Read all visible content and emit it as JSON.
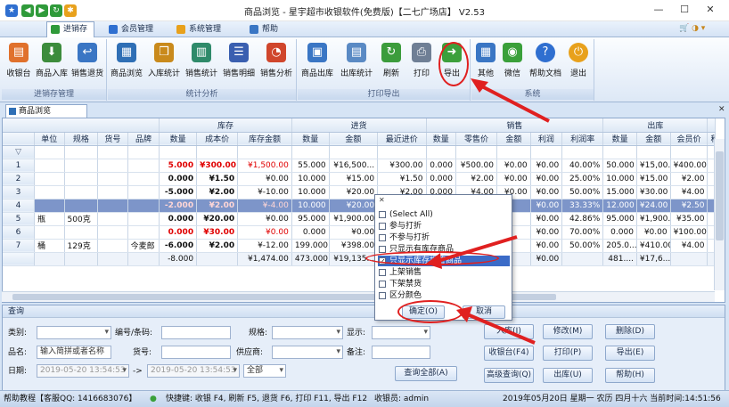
{
  "window": {
    "title": "商品浏览 - 星宇超市收银软件(免费版)【二七广场店】 V2.53",
    "controls": [
      "—",
      "☐",
      "✕"
    ]
  },
  "menu": [
    {
      "label": "进销存",
      "active": true
    },
    {
      "label": "会员管理",
      "active": false
    },
    {
      "label": "系统管理",
      "active": false
    },
    {
      "label": "帮助",
      "active": false
    }
  ],
  "ribbon": {
    "groups": [
      {
        "label": "进销存管理",
        "buttons": [
          {
            "label": "收银台",
            "icon": "cash-register-icon",
            "color": "#e0712c"
          },
          {
            "label": "商品入库",
            "icon": "stock-in-icon",
            "color": "#3c8c3c"
          },
          {
            "label": "销售退货",
            "icon": "return-icon",
            "color": "#3a76c4"
          }
        ]
      },
      {
        "label": "统计分析",
        "buttons": [
          {
            "label": "商品浏览",
            "icon": "browse-icon",
            "color": "#2f6fb5"
          },
          {
            "label": "入库统计",
            "icon": "books-icon",
            "color": "#c98a1c"
          },
          {
            "label": "销售统计",
            "icon": "sales-stat-icon",
            "color": "#2f8a6a"
          },
          {
            "label": "销售明细",
            "icon": "detail-icon",
            "color": "#3a5fb0"
          },
          {
            "label": "销售分析",
            "icon": "pie-chart-icon",
            "color": "#d0462c"
          }
        ]
      },
      {
        "label": "打印导出",
        "buttons": [
          {
            "label": "商品出库",
            "icon": "stock-out-icon",
            "color": "#3a76c4"
          },
          {
            "label": "出库统计",
            "icon": "stock-out-stat-icon",
            "color": "#5a8ac4"
          },
          {
            "label": "刷新",
            "icon": "refresh-icon",
            "color": "#3c9c3c"
          },
          {
            "label": "打印",
            "icon": "printer-icon",
            "color": "#6f7f95"
          },
          {
            "label": "导出",
            "icon": "export-icon",
            "color": "#3ca03c"
          }
        ]
      },
      {
        "label": "系统",
        "buttons": [
          {
            "label": "其他",
            "icon": "apps-icon",
            "color": "#3a76c4"
          },
          {
            "label": "微信",
            "icon": "wechat-icon",
            "color": "#3aa03a"
          },
          {
            "label": "帮助文档",
            "icon": "help-icon",
            "color": "#2f6fd0"
          },
          {
            "label": "退出",
            "icon": "exit-icon",
            "color": "#e8a11c"
          }
        ]
      }
    ]
  },
  "doc_tab": {
    "label": "商品浏览",
    "close": "✕"
  },
  "grid": {
    "group_headers": [
      {
        "label": "库存",
        "cols": 3
      },
      {
        "label": "进货",
        "cols": 3
      },
      {
        "label": "销售",
        "cols": 5
      },
      {
        "label": "出库",
        "cols": 3
      }
    ],
    "columns": [
      "单位",
      "规格",
      "货号",
      "品牌",
      "数量",
      "成本价",
      "库存金额",
      "数量",
      "金额",
      "最近进价",
      "数量",
      "零售价",
      "金额",
      "利润",
      "利润率",
      "数量",
      "金额",
      "会员价",
      "积"
    ],
    "rows": [
      {
        "n": "1",
        "cells": [
          "",
          "",
          "",
          "",
          "5.000",
          "¥300.00",
          "¥1,500.00",
          "55.000",
          "¥16,500...",
          "¥300.00",
          "0.000",
          "¥500.00",
          "¥0.00",
          "¥0.00",
          "40.00%",
          "50.000",
          "¥15,00...",
          "¥400.00",
          ""
        ],
        "red": true,
        "selected": false
      },
      {
        "n": "2",
        "cells": [
          "",
          "",
          "",
          "",
          "0.000",
          "¥1.50",
          "¥0.00",
          "10.000",
          "¥15.00",
          "¥1.50",
          "0.000",
          "¥2.00",
          "¥0.00",
          "¥0.00",
          "25.00%",
          "10.000",
          "¥15.00",
          "¥2.00",
          ""
        ],
        "red": false,
        "selected": false
      },
      {
        "n": "3",
        "cells": [
          "",
          "",
          "",
          "",
          "-5.000",
          "¥2.00",
          "¥-10.00",
          "10.000",
          "¥20.00",
          "¥2.00",
          "0.000",
          "¥4.00",
          "¥0.00",
          "¥0.00",
          "50.00%",
          "15.000",
          "¥30.00",
          "¥4.00",
          ""
        ],
        "red": false,
        "selected": false
      },
      {
        "n": "4",
        "cells": [
          "",
          "",
          "",
          "",
          "-2.000",
          "¥2.00",
          "¥-4.00",
          "10.000",
          "¥20.00",
          "",
          "",
          "",
          "",
          "¥0.00",
          "33.33%",
          "12.000",
          "¥24.00",
          "¥2.50",
          ""
        ],
        "red": true,
        "selected": true
      },
      {
        "n": "5",
        "cells": [
          "瓶",
          "500克",
          "",
          "",
          "0.000",
          "¥20.00",
          "¥0.00",
          "95.000",
          "¥1,900.00",
          "",
          "",
          "",
          "",
          "¥0.00",
          "42.86%",
          "95.000",
          "¥1,900...",
          "¥35.00",
          ""
        ],
        "red": false,
        "selected": false
      },
      {
        "n": "6",
        "cells": [
          "",
          "",
          "",
          "",
          "0.000",
          "¥30.00",
          "¥0.00",
          "0.000",
          "¥0.00",
          "",
          "",
          "",
          "",
          "¥0.00",
          "70.00%",
          "0.000",
          "¥0.00",
          "¥100.00",
          ""
        ],
        "red": true,
        "selected": false
      },
      {
        "n": "7",
        "cells": [
          "桶",
          "129克",
          "",
          "今麦郎",
          "-6.000",
          "¥2.00",
          "¥-12.00",
          "199.000",
          "¥398.00",
          "",
          "",
          "",
          "",
          "¥0.00",
          "50.00%",
          "205.0...",
          "¥410.00",
          "¥4.00",
          ""
        ],
        "red": false,
        "selected": false
      }
    ],
    "summary": [
      "",
      "",
      "",
      "",
      "-8.000",
      "",
      "¥1,474.00",
      "473.000",
      "¥19,135...",
      "",
      "",
      "",
      "",
      "¥0.00",
      "",
      "481....",
      "¥17,6...",
      "",
      ""
    ]
  },
  "filter_popup": {
    "items": [
      {
        "label": "(Select All)",
        "checked": false
      },
      {
        "label": "参与打折",
        "checked": false
      },
      {
        "label": "不参与打折",
        "checked": false
      },
      {
        "label": "只显示有库存商品",
        "checked": false
      },
      {
        "label": "只显示库存报警商品",
        "checked": true
      },
      {
        "label": "上架销售",
        "checked": false
      },
      {
        "label": "下架禁货",
        "checked": false
      },
      {
        "label": "区分颜色",
        "checked": false
      }
    ],
    "ok_label": "确定(O)",
    "cancel_label": "取消",
    "close": "✕"
  },
  "query": {
    "title": "查询",
    "category_label": "类别:",
    "barcode_label": "编号/条码:",
    "spec_label": "规格:",
    "display_label": "显示:",
    "name_label": "品名:",
    "name_placeholder": "输入简拼或者名称",
    "sku_label": "货号:",
    "supplier_label": "供应商:",
    "note_label": "备注:",
    "date_label": "日期:",
    "date_from": "2019-05-20 13:54:53",
    "date_to": "2019-05-20 13:54:53",
    "date_arrow": "->",
    "range_value": "全部",
    "buttons": {
      "stock_in": "入库(I)",
      "edit": "修改(M)",
      "delete": "删除(D)",
      "cashier": "收银台(F4)",
      "print": "打印(P)",
      "export": "导出(E)",
      "query_all": "查询全部(A)",
      "advanced": "高级查询(Q)",
      "stock_out": "出库(U)",
      "help": "帮助(H)"
    }
  },
  "status": {
    "help": "帮助教程【客服QQ: 1416683076】",
    "shortcuts": "快捷键: 收银 F4, 刷新 F5, 退货 F6, 打印 F11, 导出 F12",
    "cashier": "收银员: admin",
    "datetime": "2019年05月20日 星期一 农历 四月十六 当前时间:14:51:56"
  }
}
